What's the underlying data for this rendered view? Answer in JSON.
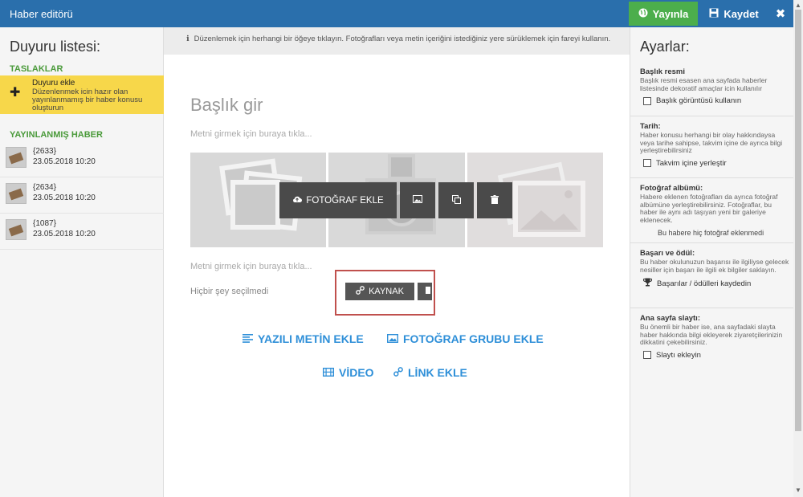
{
  "topbar": {
    "title": "Haber editörü",
    "publish_label": "Yayınla",
    "save_label": "Kaydet",
    "close_glyph": "✖"
  },
  "left": {
    "title": "Duyuru listesi:",
    "drafts_label": "TASLAKLAR",
    "draft_item": {
      "title": "Duyuru ekle",
      "desc": "Düzenlenmek icin hazır olan yayınlanmamış bir haber konusu oluşturun"
    },
    "published_label": "YAYINLANMIŞ HABER",
    "news": [
      {
        "id": "{2633}",
        "date": "23.05.2018 10:20"
      },
      {
        "id": "{2634}",
        "date": "23.05.2018 10:20"
      },
      {
        "id": "{1087}",
        "date": "23.05.2018 10:20"
      }
    ]
  },
  "editor": {
    "info": "Düzenlemek için herhangi bir öğeye tıklayın. Fotoğrafları veya metin içeriğini istediğiniz yere sürüklemek için fareyi kullanın.",
    "heading_placeholder": "Başlık gir",
    "text_hint_1": "Metni girmek için buraya tıkla...",
    "text_hint_2": "Metni girmek için buraya tıkla...",
    "add_photo_label": "FOTOĞRAF EKLE",
    "no_selection": "Hiçbir şey seçilmedi",
    "source_label": "KAYNAK",
    "add_text_label": "YAZILI METİN EKLE",
    "add_photo_group_label": "FOTOĞRAF GRUBU EKLE",
    "add_video_label": "VİDEO",
    "add_link_label": "LİNK EKLE"
  },
  "right": {
    "title": "Ayarlar:",
    "settings": [
      {
        "title": "Başlık resmi",
        "desc": "Başlık resmi esasen ana sayfada haberler listesinde dekoratif amaçlar icin kullanılır",
        "control": "Başlık görüntüsü kullanın"
      },
      {
        "title": "Tarih:",
        "desc": "Haber konusu herhangi bir olay hakkındaysa veya tarihe sahipse, takvim içine de ayrıca bilgi yerleştirebilirsiniz",
        "control": "Takvim içine yerleştir"
      },
      {
        "title": "Fotoğraf albümü:",
        "desc": "Habere eklenen fotoğrafları da ayrıca fotoğraf albümüne yerleştirebilirsiniz. Fotoğraflar, bu haber ile aynı adı taşıyan yeni bir galeriye eklenecek.",
        "control": "Bu habere hiç fotoğraf eklenmedi"
      },
      {
        "title": "Başarı ve ödül:",
        "desc": "Bu haber okulunuzun başarısı ile ilgiliyse gelecek nesiller için başarı ile ilgili ek bilgiler saklayın.",
        "control": "Başarılar / ödülleri kaydedin"
      },
      {
        "title": "Ana sayfa slaytı:",
        "desc": "Bu önemli bir haber ise, ana sayfadaki slayta haber hakkında bilgi ekleyerek ziyaretçilerinizin dikkatini çekebilirsiniz.",
        "control": "Slaytı ekleyin"
      }
    ]
  },
  "colors": {
    "topbar": "#2a6fac",
    "publish": "#4cae4c",
    "accent_link": "#2e8fd8",
    "draft_bg": "#f7d74a",
    "highlight": "#c0504d"
  }
}
